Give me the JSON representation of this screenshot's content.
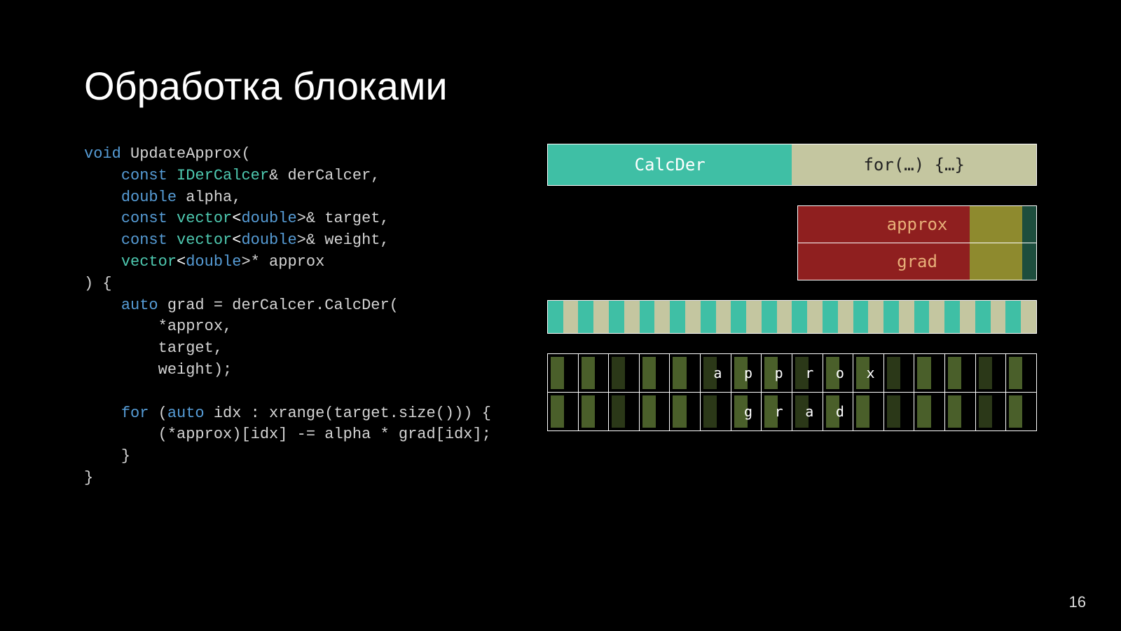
{
  "title": "Обработка блоками",
  "page_number": "16",
  "code": {
    "l1_kw": "void",
    "l1_fn": "UpdateApprox",
    "l1_p": "(",
    "l2_kw": "const",
    "l2_ty": "IDerCalcer",
    "l2_rest": "& derCalcer,",
    "l3_kw": "double",
    "l3_rest": " alpha,",
    "l4_kw": "const",
    "l4_ty": "vector",
    "l4_tp": "double",
    "l4_rest": ">& target,",
    "l5_kw": "const",
    "l5_ty": "vector",
    "l5_tp": "double",
    "l5_rest": ">& weight,",
    "l6_ty": "vector",
    "l6_tp": "double",
    "l6_rest": ">* approx",
    "l7": ") {",
    "l8_kw": "auto",
    "l8_rest": " grad = derCalcer.CalcDer(",
    "l9": "*approx,",
    "l10": "target,",
    "l11": "weight);",
    "l12_kw": "for",
    "l12_kw2": "auto",
    "l12a": " (",
    "l12b": " idx : xrange(target.size())) {",
    "l13": "(*approx)[idx] -= alpha * grad[idx];",
    "l14": "}",
    "l15": "}"
  },
  "top_bar": {
    "left": "CalcDer",
    "right": "for(…) {…}"
  },
  "mem": {
    "row1": "approx",
    "row2": "grad",
    "a_frac": 0.72,
    "b_frac": 0.22,
    "c_frac": 0.06
  },
  "stripe_count": 32,
  "green_cells_per_row": 16,
  "letters_row1": [
    "",
    "",
    "",
    "",
    "",
    "a",
    "p",
    "p",
    "r",
    "o",
    "x",
    "",
    "",
    "",
    "",
    ""
  ],
  "letters_row2": [
    "",
    "",
    "",
    "",
    "",
    "",
    "g",
    "r",
    "a",
    "d",
    "",
    "",
    "",
    "",
    "",
    ""
  ]
}
